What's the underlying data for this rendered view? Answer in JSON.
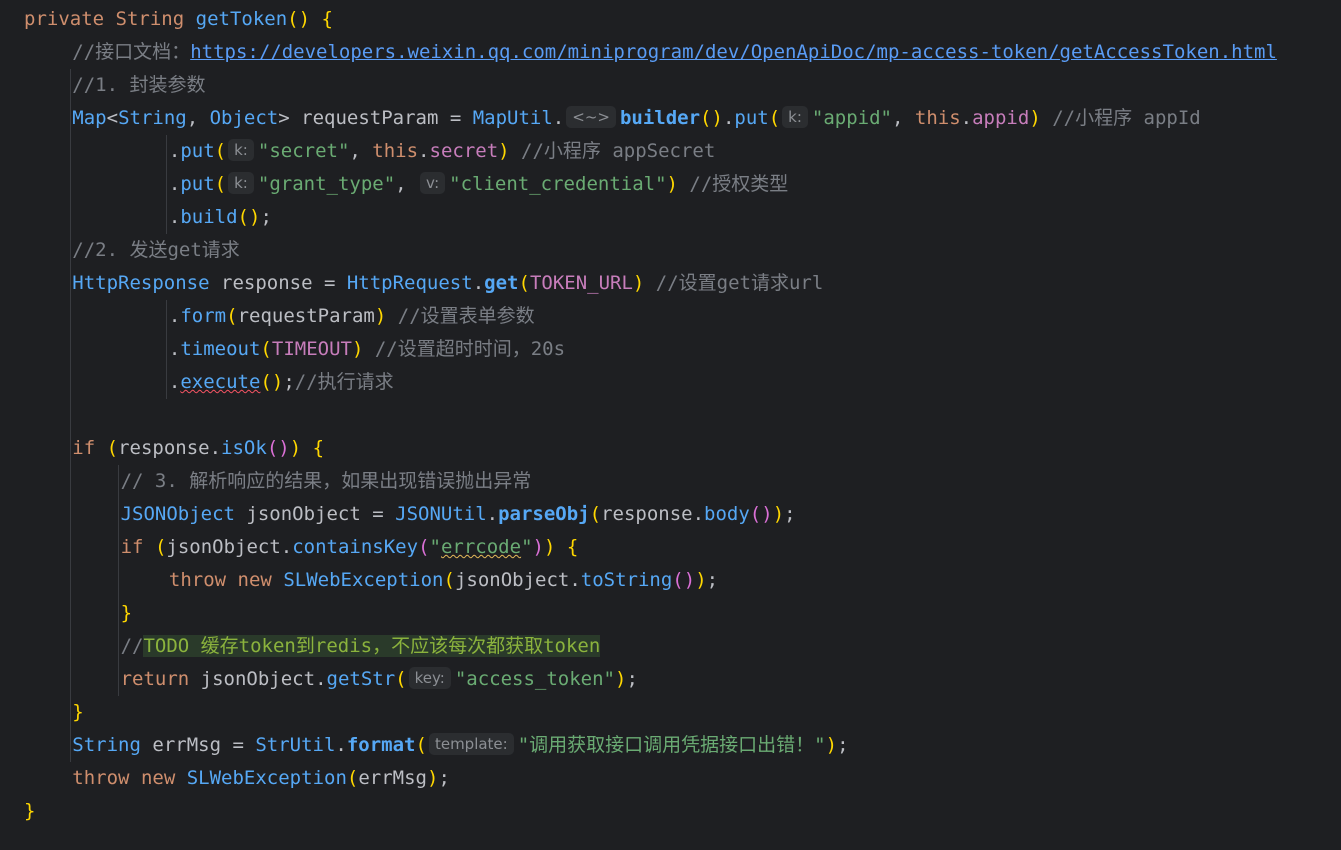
{
  "code": [
    [
      {
        "t": "private",
        "c": "kw"
      },
      {
        "t": " "
      },
      {
        "t": "String",
        "c": "kw"
      },
      {
        "t": " "
      },
      {
        "t": "getToken",
        "c": "fn"
      },
      {
        "t": "()",
        "c": "br1"
      },
      {
        "t": " "
      },
      {
        "t": "{",
        "c": "br1"
      }
    ],
    [
      {
        "t": "//接口文档：",
        "c": "cm"
      },
      {
        "t": "https://developers.weixin.qq.com/miniprogram/dev/OpenApiDoc/mp-access-token/getAccessToken.html",
        "c": "link"
      }
    ],
    [
      {
        "t": "//1. 封装参数",
        "c": "cm"
      }
    ],
    [
      {
        "t": "Map",
        "c": "ty"
      },
      {
        "t": "<"
      },
      {
        "t": "String",
        "c": "ty"
      },
      {
        "t": ", "
      },
      {
        "t": "Object",
        "c": "ty"
      },
      {
        "t": "> requestParam = "
      },
      {
        "t": "MapUtil",
        "c": "ty"
      },
      {
        "t": "."
      },
      {
        "h": "<~>"
      },
      {
        "t": "builder",
        "c": "fnb"
      },
      {
        "t": "()",
        "c": "br1"
      },
      {
        "t": "."
      },
      {
        "t": "put",
        "c": "mb"
      },
      {
        "t": "(",
        "c": "br1"
      },
      {
        "h": "k:"
      },
      {
        "t": "\"appid\"",
        "c": "st"
      },
      {
        "t": ", "
      },
      {
        "t": "this",
        "c": "kw"
      },
      {
        "t": "."
      },
      {
        "t": "appid",
        "c": "fd"
      },
      {
        "t": ")",
        "c": "br1"
      },
      {
        "t": " "
      },
      {
        "t": "//小程序 appId",
        "c": "cm"
      }
    ],
    [
      {
        "t": "."
      },
      {
        "t": "put",
        "c": "mb"
      },
      {
        "t": "(",
        "c": "br1"
      },
      {
        "h": "k:"
      },
      {
        "t": "\"secret\"",
        "c": "st"
      },
      {
        "t": ", "
      },
      {
        "t": "this",
        "c": "kw"
      },
      {
        "t": "."
      },
      {
        "t": "secret",
        "c": "fd"
      },
      {
        "t": ")",
        "c": "br1"
      },
      {
        "t": " "
      },
      {
        "t": "//小程序 appSecret",
        "c": "cm"
      }
    ],
    [
      {
        "t": "."
      },
      {
        "t": "put",
        "c": "mb"
      },
      {
        "t": "(",
        "c": "br1"
      },
      {
        "h": "k:"
      },
      {
        "t": "\"grant_type\"",
        "c": "st"
      },
      {
        "t": ", "
      },
      {
        "h": "v:"
      },
      {
        "t": "\"client_credential\"",
        "c": "st"
      },
      {
        "t": ")",
        "c": "br1"
      },
      {
        "t": " "
      },
      {
        "t": "//授权类型",
        "c": "cm"
      }
    ],
    [
      {
        "t": "."
      },
      {
        "t": "build",
        "c": "mb"
      },
      {
        "t": "()",
        "c": "br1"
      },
      {
        "t": ";"
      }
    ],
    [
      {
        "t": "//2. 发送get请求",
        "c": "cm"
      }
    ],
    [
      {
        "t": "HttpResponse",
        "c": "ty"
      },
      {
        "t": " response = "
      },
      {
        "t": "HttpRequest",
        "c": "ty"
      },
      {
        "t": "."
      },
      {
        "t": "get",
        "c": "fnb"
      },
      {
        "t": "(",
        "c": "br1"
      },
      {
        "t": "TOKEN_URL",
        "c": "cn"
      },
      {
        "t": ")",
        "c": "br1"
      },
      {
        "t": " "
      },
      {
        "t": "//设置get请求url",
        "c": "cm"
      }
    ],
    [
      {
        "t": "."
      },
      {
        "t": "form",
        "c": "mb"
      },
      {
        "t": "(",
        "c": "br1"
      },
      {
        "t": "requestParam"
      },
      {
        "t": ")",
        "c": "br1"
      },
      {
        "t": " "
      },
      {
        "t": "//设置表单参数",
        "c": "cm"
      }
    ],
    [
      {
        "t": "."
      },
      {
        "t": "timeout",
        "c": "mb"
      },
      {
        "t": "(",
        "c": "br1"
      },
      {
        "t": "TIMEOUT",
        "c": "cn"
      },
      {
        "t": ")",
        "c": "br1"
      },
      {
        "t": " "
      },
      {
        "t": "//设置超时时间，20s",
        "c": "cm"
      }
    ],
    [
      {
        "t": "."
      },
      {
        "t": "execute",
        "c": "mb",
        "u": "err"
      },
      {
        "t": "()",
        "c": "br1"
      },
      {
        "t": ";"
      },
      {
        "t": "//执行请求",
        "c": "cm"
      }
    ],
    [],
    [
      {
        "t": "if",
        "c": "kw"
      },
      {
        "t": " "
      },
      {
        "t": "(",
        "c": "br1"
      },
      {
        "t": "response."
      },
      {
        "t": "isOk",
        "c": "mb"
      },
      {
        "t": "()",
        "c": "br2"
      },
      {
        "t": ")",
        "c": "br1"
      },
      {
        "t": " "
      },
      {
        "t": "{",
        "c": "br1"
      }
    ],
    [
      {
        "t": "// 3. 解析响应的结果，如果出现错误抛出异常",
        "c": "cm"
      }
    ],
    [
      {
        "t": "JSONObject",
        "c": "ty"
      },
      {
        "t": " jsonObject = "
      },
      {
        "t": "JSONUtil",
        "c": "ty"
      },
      {
        "t": "."
      },
      {
        "t": "parseObj",
        "c": "fnb"
      },
      {
        "t": "(",
        "c": "br1"
      },
      {
        "t": "response."
      },
      {
        "t": "body",
        "c": "mb"
      },
      {
        "t": "()",
        "c": "br2"
      },
      {
        "t": ")",
        "c": "br1"
      },
      {
        "t": ";"
      }
    ],
    [
      {
        "t": "if",
        "c": "kw"
      },
      {
        "t": " "
      },
      {
        "t": "(",
        "c": "br1"
      },
      {
        "t": "jsonObject."
      },
      {
        "t": "containsKey",
        "c": "mb"
      },
      {
        "t": "(",
        "c": "br2"
      },
      {
        "t": "\"",
        "c": "st"
      },
      {
        "t": "errcode",
        "c": "st",
        "u": "typo"
      },
      {
        "t": "\"",
        "c": "st"
      },
      {
        "t": ")",
        "c": "br2"
      },
      {
        "t": ")",
        "c": "br1"
      },
      {
        "t": " "
      },
      {
        "t": "{",
        "c": "br1"
      }
    ],
    [
      {
        "t": "throw",
        "c": "kw"
      },
      {
        "t": " "
      },
      {
        "t": "new",
        "c": "kw"
      },
      {
        "t": " "
      },
      {
        "t": "SLWebException",
        "c": "ty"
      },
      {
        "t": "(",
        "c": "br1"
      },
      {
        "t": "jsonObject."
      },
      {
        "t": "toString",
        "c": "mb"
      },
      {
        "t": "()",
        "c": "br2"
      },
      {
        "t": ")",
        "c": "br1"
      },
      {
        "t": ";"
      }
    ],
    [
      {
        "t": "}",
        "c": "br1"
      }
    ],
    [
      {
        "t": "//",
        "c": "cm"
      },
      {
        "t": "TODO 缓存token到redis，不应该每次都获取token",
        "c": "todo",
        "u": "todohl"
      }
    ],
    [
      {
        "t": "return",
        "c": "kw"
      },
      {
        "t": " jsonObject."
      },
      {
        "t": "getStr",
        "c": "mb"
      },
      {
        "t": "(",
        "c": "br1"
      },
      {
        "h": "key:"
      },
      {
        "t": "\"access_token\"",
        "c": "st"
      },
      {
        "t": ")",
        "c": "br1"
      },
      {
        "t": ";"
      }
    ],
    [
      {
        "t": "}",
        "c": "br1"
      }
    ],
    [
      {
        "t": "String",
        "c": "ty"
      },
      {
        "t": " errMsg = "
      },
      {
        "t": "StrUtil",
        "c": "ty"
      },
      {
        "t": "."
      },
      {
        "t": "format",
        "c": "fnb"
      },
      {
        "t": "(",
        "c": "br1"
      },
      {
        "h": "template:"
      },
      {
        "t": "\"调用获取接口调用凭据接口出错！\"",
        "c": "st"
      },
      {
        "t": ")",
        "c": "br1"
      },
      {
        "t": ";"
      }
    ],
    [
      {
        "t": "throw",
        "c": "kw"
      },
      {
        "t": " "
      },
      {
        "t": "new",
        "c": "kw"
      },
      {
        "t": " "
      },
      {
        "t": "SLWebException",
        "c": "ty"
      },
      {
        "t": "(",
        "c": "br1"
      },
      {
        "t": "errMsg"
      },
      {
        "t": ")",
        "c": "br1"
      },
      {
        "t": ";"
      }
    ],
    [
      {
        "t": "}",
        "c": "br1"
      }
    ]
  ],
  "colors": {
    "background": "#1e1f22",
    "keyword": "#cf8e6d",
    "string": "#6aab73",
    "comment": "#7a7e85",
    "method": "#56a8f5",
    "field": "#c77dbb",
    "bracket": "#ffd700"
  }
}
